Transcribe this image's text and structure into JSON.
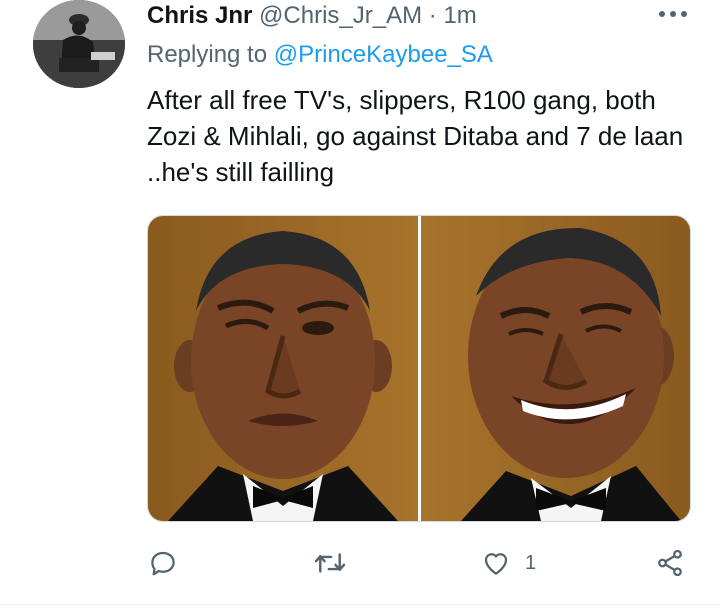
{
  "tweet": {
    "author_name": "Chris Jnr",
    "author_handle": "@Chris_Jr_AM",
    "separator": "·",
    "timestamp": "1m",
    "reply_prefix": "Replying to",
    "reply_to": "@PrinceKaybee_SA",
    "text": "After all free TV's, slippers, R100 gang, both Zozi & Mihlali, go against Ditaba and 7 de laan ..he's still failling",
    "media": [
      {
        "icon": "photo-wink-face"
      },
      {
        "icon": "photo-laughing-face"
      }
    ]
  },
  "actions": {
    "reply": {
      "icon": "reply-icon",
      "count": ""
    },
    "retweet": {
      "icon": "retweet-icon",
      "count": ""
    },
    "like": {
      "icon": "heart-icon",
      "count": "1"
    },
    "share": {
      "icon": "share-icon",
      "count": ""
    }
  },
  "colors": {
    "accent": "#1d9bf0",
    "text": "#0f1419",
    "muted": "#536471",
    "border": "#cfd9de"
  }
}
